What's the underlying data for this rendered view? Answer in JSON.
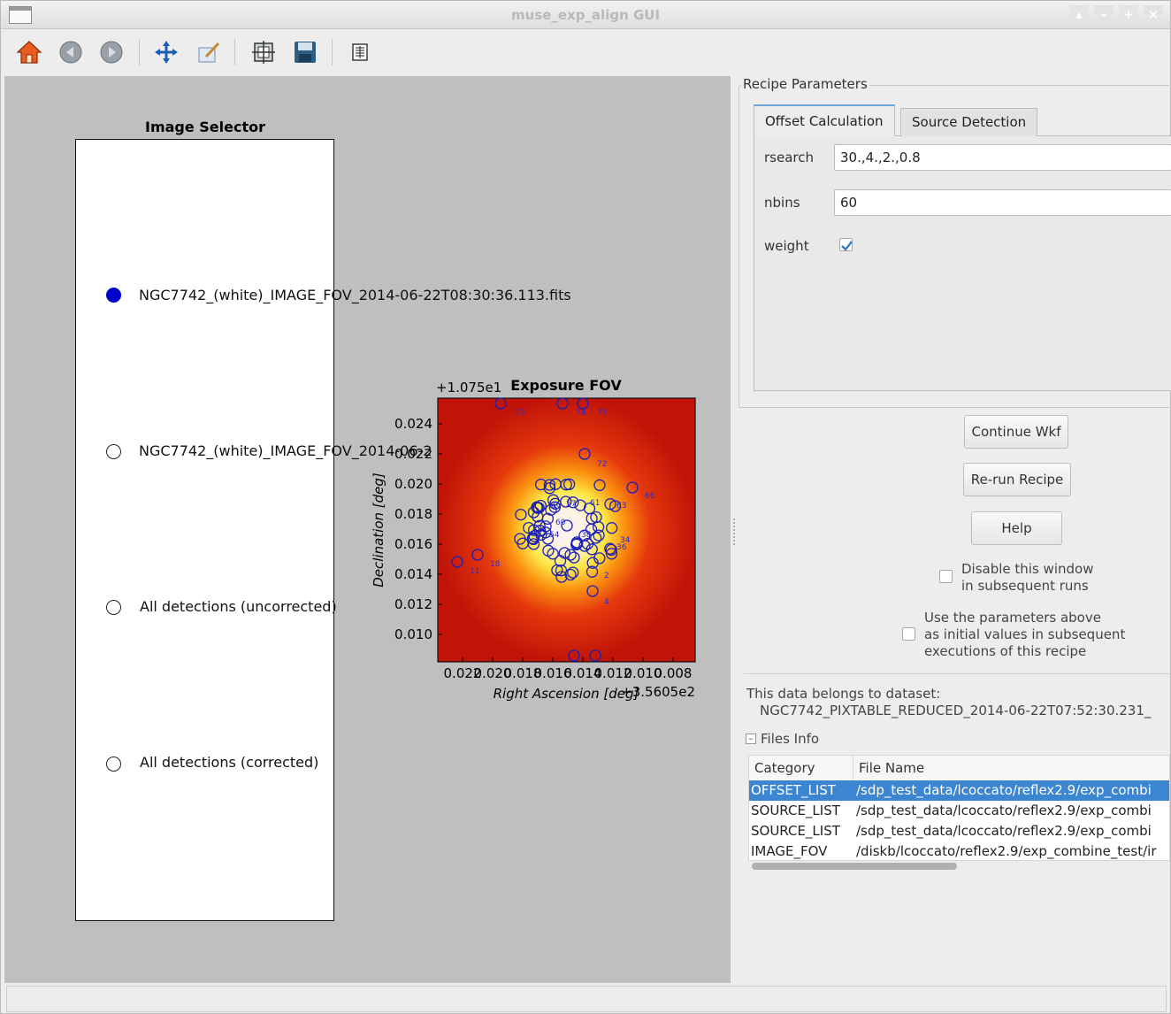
{
  "window": {
    "title": "muse_exp_align GUI"
  },
  "toolbar": {
    "icons": [
      "home-icon",
      "back-icon",
      "forward-icon",
      "pan-icon",
      "zoom-edit-icon",
      "configure-subplots-icon",
      "save-icon",
      "data-icon"
    ]
  },
  "selector": {
    "title": "Image Selector",
    "options": [
      {
        "label": "NGC7742_(white)_IMAGE_FOV_2014-06-22T08:30:36.113.fits",
        "selected": true
      },
      {
        "label": "NGC7742_(white)_IMAGE_FOV_2014-06-2",
        "selected": false
      },
      {
        "label": "All detections (uncorrected)",
        "selected": false
      },
      {
        "label": "All detections (corrected)",
        "selected": false
      }
    ]
  },
  "plot": {
    "title": "Exposure FOV",
    "y_offset": "+1.075e1",
    "x_offset": "+3.5605e2",
    "xlabel": "Right Ascension [deg]",
    "ylabel": "Declination [deg]",
    "xticks": [
      "0.022",
      "0.020",
      "0.018",
      "0.016",
      "0.014",
      "0.012",
      "0.010",
      "0.008"
    ],
    "yticks": [
      "0.024",
      "0.022",
      "0.020",
      "0.018",
      "0.016",
      "0.014",
      "0.012",
      "0.010"
    ]
  },
  "chart_data": {
    "type": "scatter",
    "title": "Exposure FOV",
    "xlabel": "Right Ascension [deg]",
    "ylabel": "Declination [deg]",
    "xlim": [
      0.023,
      0.007
    ],
    "ylim": [
      0.0092,
      0.0252
    ],
    "x_offset": 356.05,
    "y_offset": 10.75,
    "source_labels": [
      "73",
      "74",
      "75",
      "72",
      "66",
      "11",
      "18",
      "38",
      "49",
      "57",
      "61",
      "63",
      "60",
      "54",
      "36",
      "34",
      "2",
      "4"
    ]
  },
  "recipe": {
    "group_label": "Recipe Parameters",
    "tabs": [
      "Offset Calculation",
      "Source Detection"
    ],
    "params": [
      {
        "name": "rsearch",
        "value": "30.,4.,2.,0.8"
      },
      {
        "name": "nbins",
        "value": "60"
      },
      {
        "name": "weight",
        "checked": true
      }
    ]
  },
  "buttons": {
    "continue": "Continue Wkf",
    "rerun": "Re-run Recipe",
    "help": "Help"
  },
  "options": {
    "disable_line1": "Disable this window",
    "disable_line2": "in subsequent runs",
    "use_line1": "Use the parameters above",
    "use_line2": "as initial values in subsequent",
    "use_line3": "executions of this recipe"
  },
  "dataset": {
    "label": "This data belongs to dataset:",
    "name": "NGC7742_PIXTABLE_REDUCED_2014-06-22T07:52:30.231_"
  },
  "files": {
    "toggle": "Files Info",
    "headers": [
      "Category",
      "File Name"
    ],
    "rows": [
      {
        "category": "OFFSET_LIST",
        "file": "/sdp_test_data/lcoccato/reflex2.9/exp_combi"
      },
      {
        "category": "SOURCE_LIST",
        "file": "/sdp_test_data/lcoccato/reflex2.9/exp_combi"
      },
      {
        "category": "SOURCE_LIST",
        "file": "/sdp_test_data/lcoccato/reflex2.9/exp_combi"
      },
      {
        "category": "IMAGE_FOV",
        "file": "/diskb/lcoccato/reflex2.9/exp_combine_test/ir"
      }
    ]
  },
  "colors": {
    "selected_row": "#3c85d1",
    "radio_on": "#0000cc",
    "tab_accent": "#6aa6d8"
  }
}
